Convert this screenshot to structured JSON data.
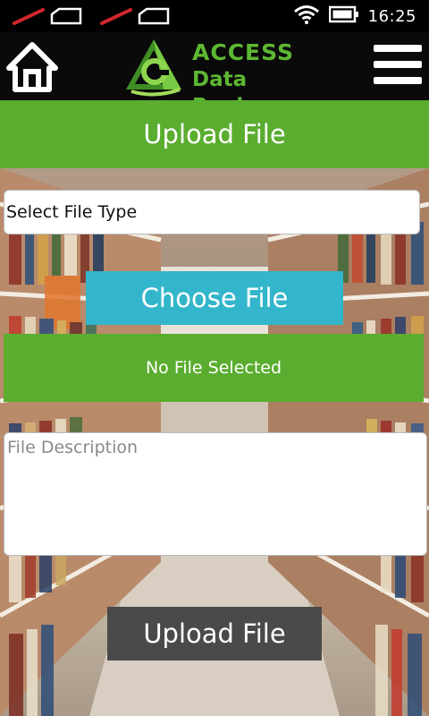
{
  "status_bar": {
    "time": "16:25",
    "icons": [
      "sim-no-signal-icon",
      "sim-no-signal-icon",
      "wifi-icon",
      "battery-icon"
    ]
  },
  "header": {
    "home_icon": "home-icon",
    "logo": {
      "line1": "ACCESS",
      "line2": "Data Bank"
    },
    "menu_icon": "hamburger-menu-icon"
  },
  "title": "Upload File",
  "form": {
    "file_type_select": {
      "value": "Select File Type"
    },
    "choose_button_label": "Choose File",
    "file_status": "No File Selected",
    "description": {
      "placeholder": "File Description",
      "value": ""
    },
    "upload_button_label": "Upload File"
  },
  "colors": {
    "brand_green": "#5aad2f",
    "choose_button": "#33b6cb",
    "upload_button": "#4a4a4a",
    "header_bg": "#0a0a0a"
  }
}
